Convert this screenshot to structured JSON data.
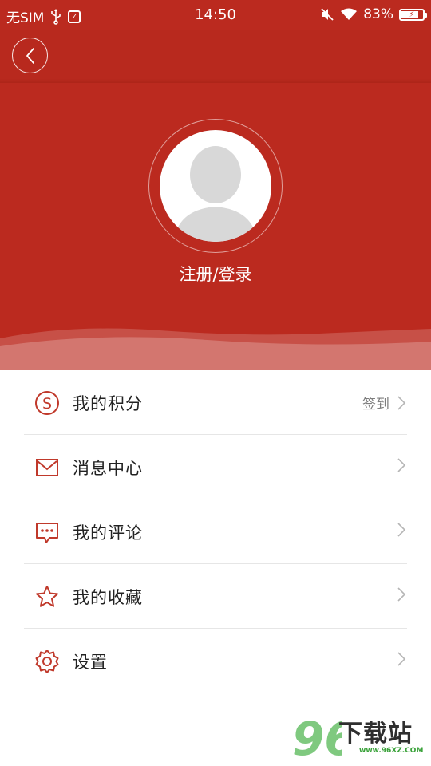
{
  "status_bar": {
    "carrier": "无SIM",
    "time": "14:50",
    "battery_text": "83%",
    "battery_level": 0.83
  },
  "header": {
    "back_icon": "chevron-left-icon",
    "login_text": "注册/登录"
  },
  "menu": {
    "items": [
      {
        "label": "我的积分",
        "icon": "points-s-icon",
        "extra": "签到"
      },
      {
        "label": "消息中心",
        "icon": "envelope-icon",
        "extra": ""
      },
      {
        "label": "我的评论",
        "icon": "comment-bubble-icon",
        "extra": ""
      },
      {
        "label": "我的收藏",
        "icon": "star-icon",
        "extra": ""
      },
      {
        "label": "设置",
        "icon": "gear-icon",
        "extra": ""
      }
    ]
  },
  "watermark": {
    "logo_digits": "96",
    "text": "下载站",
    "url": "www.96XZ.COM"
  },
  "colors": {
    "brand_red": "#bb2a1f",
    "icon_red": "#c0392b",
    "watermark_green": "#3aa23a"
  }
}
